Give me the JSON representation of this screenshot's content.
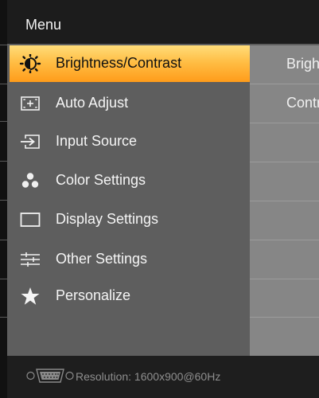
{
  "header": {
    "title": "Menu"
  },
  "menu": {
    "items": [
      {
        "label": "Brightness/Contrast",
        "icon": "brightness-icon",
        "selected": true
      },
      {
        "label": "Auto Adjust",
        "icon": "auto-adjust-icon",
        "selected": false
      },
      {
        "label": "Input Source",
        "icon": "input-source-icon",
        "selected": false
      },
      {
        "label": "Color Settings",
        "icon": "color-settings-icon",
        "selected": false
      },
      {
        "label": "Display Settings",
        "icon": "display-settings-icon",
        "selected": false
      },
      {
        "label": "Other Settings",
        "icon": "other-settings-icon",
        "selected": false
      },
      {
        "label": "Personalize",
        "icon": "star-icon",
        "selected": false
      }
    ]
  },
  "submenu": {
    "items": [
      {
        "label": "Brightness"
      },
      {
        "label": "Contrast"
      }
    ]
  },
  "footer": {
    "resolution": "Resolution:  1600x900@60Hz",
    "icon": "vga-connector-icon"
  },
  "colors": {
    "selected_highlight": "#ffb43a",
    "menu_bg": "#5e5e5e",
    "submenu_bg": "#868686",
    "header_bg": "#1c1c1c"
  }
}
